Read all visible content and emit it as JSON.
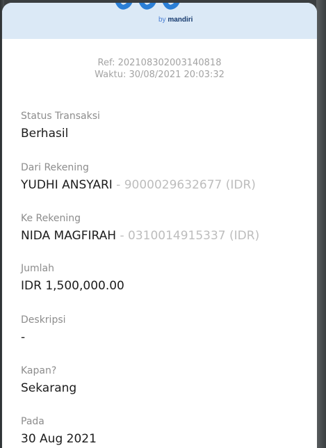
{
  "header": {
    "logo_by": "by",
    "logo_brand": "mandiri",
    "brand_color": "#163a6e",
    "accent_color": "#4a7fd4"
  },
  "receipt": {
    "ref": "Ref: 202108302003140818",
    "waktu": "Waktu: 30/08/2021 20:03:32"
  },
  "fields": {
    "status": {
      "label": "Status Transaksi",
      "value": "Berhasil"
    },
    "dari": {
      "label": "Dari Rekening",
      "name": "YUDHI ANSYARI",
      "account": " - 9000029632677 (IDR)"
    },
    "ke": {
      "label": "Ke Rekening",
      "name": "NIDA MAGFIRAH",
      "account": " - 0310014915337 (IDR)"
    },
    "jumlah": {
      "label": "Jumlah",
      "value": "IDR 1,500,000.00"
    },
    "deskripsi": {
      "label": "Deskripsi",
      "value": "-"
    },
    "kapan": {
      "label": "Kapan?",
      "value": "Sekarang"
    },
    "pada": {
      "label": "Pada",
      "value": "30 Aug 2021"
    }
  }
}
